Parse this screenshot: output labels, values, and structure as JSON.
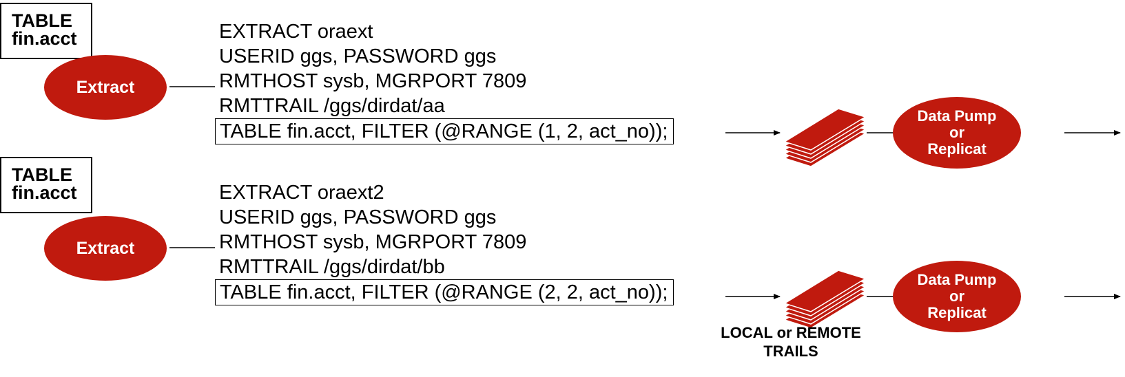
{
  "groups": [
    {
      "source_table": [
        "TABLE",
        "fin.acct"
      ],
      "process_label": "Extract",
      "param_lines": [
        "EXTRACT oraext",
        "USERID ggs, PASSWORD ggs",
        "RMTHOST sysb, MGRPORT 7809",
        "RMTTRAIL /ggs/dirdat/aa"
      ],
      "table_statement": "TABLE fin.acct, FILTER (@RANGE (1, 2, act_no));",
      "target_label": [
        "Data Pump",
        "or",
        "Replicat"
      ]
    },
    {
      "source_table": [
        "TABLE",
        "fin.acct"
      ],
      "process_label": "Extract",
      "param_lines": [
        "EXTRACT oraext2",
        "USERID ggs, PASSWORD ggs",
        "RMTHOST sysb, MGRPORT 7809",
        "RMTTRAIL /ggs/dirdat/bb"
      ],
      "table_statement": "TABLE fin.acct, FILTER (@RANGE (2, 2, act_no));",
      "target_label": [
        "Data Pump",
        "or",
        "Replicat"
      ]
    }
  ],
  "trail_label": [
    "LOCAL or REMOTE",
    "TRAILS"
  ],
  "colors": {
    "accent": "#c01a0e",
    "line": "#000000",
    "background": "#ffffff"
  },
  "icons": [
    "trail-files-icon",
    "arrow-icon"
  ]
}
